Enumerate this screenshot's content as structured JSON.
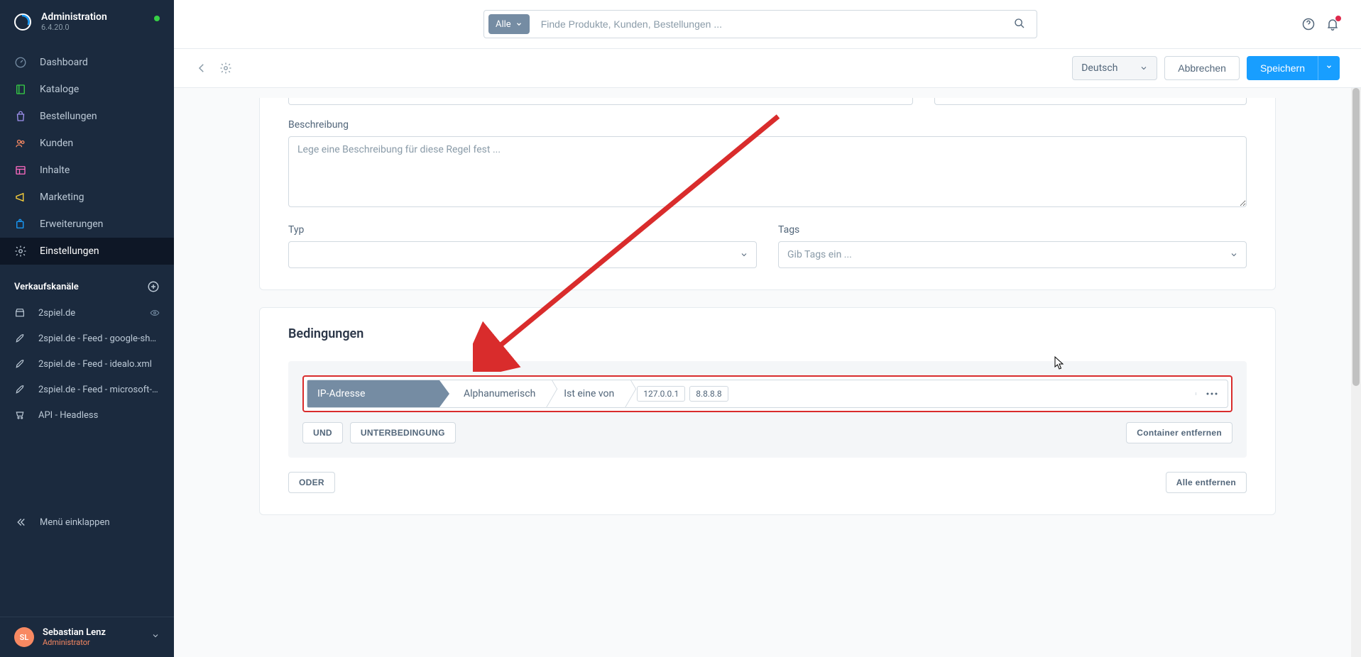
{
  "sidebar": {
    "title": "Administration",
    "version": "6.4.20.0",
    "nav": [
      {
        "label": "Dashboard",
        "icon": "gauge"
      },
      {
        "label": "Kataloge",
        "icon": "book"
      },
      {
        "label": "Bestellungen",
        "icon": "bag"
      },
      {
        "label": "Kunden",
        "icon": "users"
      },
      {
        "label": "Inhalte",
        "icon": "layout"
      },
      {
        "label": "Marketing",
        "icon": "megaphone"
      },
      {
        "label": "Erweiterungen",
        "icon": "puzzle"
      },
      {
        "label": "Einstellungen",
        "icon": "gear",
        "active": true
      }
    ],
    "sales_header": "Verkaufskanäle",
    "sales": [
      {
        "label": "2spiel.de",
        "icon": "store",
        "eye": true
      },
      {
        "label": "2spiel.de - Feed - google-shoppi...",
        "icon": "rocket"
      },
      {
        "label": "2spiel.de - Feed - idealo.xml",
        "icon": "rocket"
      },
      {
        "label": "2spiel.de - Feed - microsoft-ads....",
        "icon": "rocket"
      },
      {
        "label": "API - Headless",
        "icon": "cart"
      }
    ],
    "collapse_label": "Menü einklappen",
    "user": {
      "initials": "SL",
      "name": "Sebastian Lenz",
      "role": "Administrator"
    }
  },
  "topbar": {
    "search_scope": "Alle",
    "search_placeholder": "Finde Produkte, Kunden, Bestellungen ..."
  },
  "actionbar": {
    "language": "Deutsch",
    "cancel": "Abbrechen",
    "save": "Speichern"
  },
  "form": {
    "description_label": "Beschreibung",
    "description_placeholder": "Lege eine Beschreibung für diese Regel fest ...",
    "type_label": "Typ",
    "tags_label": "Tags",
    "tags_placeholder": "Gib Tags ein ..."
  },
  "conditions": {
    "title": "Bedingungen",
    "rule": {
      "field": "IP-Adresse",
      "format": "Alphanumerisch",
      "operator": "Ist eine von",
      "values": [
        "127.0.0.1",
        "8.8.8.8"
      ]
    },
    "and_btn": "UND",
    "sub_btn": "UNTERBEDINGUNG",
    "remove_container": "Container entfernen",
    "or_btn": "ODER",
    "remove_all": "Alle entfernen"
  }
}
